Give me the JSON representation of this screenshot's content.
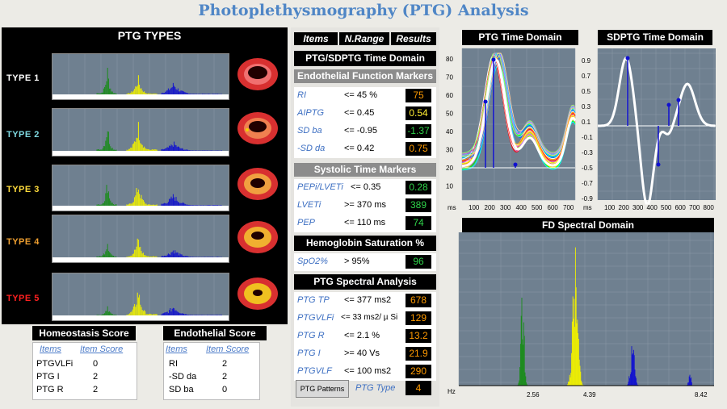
{
  "title": "Photoplethysmography (PTG) Analysis",
  "types_panel": {
    "title": "PTG TYPES",
    "types": [
      {
        "label": "TYPE 1",
        "color": "#ffffff"
      },
      {
        "label": "TYPE 2",
        "color": "#7fd8e0"
      },
      {
        "label": "TYPE 3",
        "color": "#ffdc3c"
      },
      {
        "label": "TYPE 4",
        "color": "#f0a030"
      },
      {
        "label": "TYPE 5",
        "color": "#ff2020"
      }
    ]
  },
  "homeostasis": {
    "title": "Homeostasis Score",
    "col_items": "Items",
    "col_score": "Item Score",
    "rows": [
      {
        "item": "PTGVLFi",
        "score": "0"
      },
      {
        "item": "PTG I",
        "score": "2"
      },
      {
        "item": "PTG R",
        "score": "2"
      }
    ]
  },
  "endothelial": {
    "title": "Endothelial Score",
    "col_items": "Items",
    "col_score": "Item Score",
    "rows": [
      {
        "item": "RI",
        "score": "2"
      },
      {
        "item": "-SD da",
        "score": "2"
      },
      {
        "item": "SD ba",
        "score": "0"
      }
    ]
  },
  "middle": {
    "headers": {
      "items": "Items",
      "range": "N.Range",
      "results": "Results"
    },
    "time_domain_title": "PTG/SDPTG Time Domain",
    "endothelial_title": "Endothelial Function Markers",
    "endothelial_rows": [
      {
        "name": "RI",
        "range": "<= 45 %",
        "value": "75"
      },
      {
        "name": "AIPTG",
        "range": "<= 0.45",
        "value": "0.54"
      },
      {
        "name": "SD ba",
        "range": "<= -0.95",
        "value": "-1.37"
      },
      {
        "name": "-SD da",
        "range": "<= 0.42",
        "value": "0.75"
      }
    ],
    "systolic_title": "Systolic Time Markers",
    "systolic_rows": [
      {
        "name": "PEPi/LVETi",
        "range": "<= 0.35",
        "value": "0.28"
      },
      {
        "name": "LVETi",
        "range": ">= 370 ms",
        "value": "389"
      },
      {
        "name": "PEP",
        "range": "<= 110 ms",
        "value": "74"
      }
    ],
    "hemoglobin_title": "Hemoglobin Saturation %",
    "hemoglobin_rows": [
      {
        "name": "SpO2%",
        "range": "> 95%",
        "value": "96"
      }
    ],
    "spectral_title": "PTG Spectral Analysis",
    "spectral_rows": [
      {
        "name": "PTG TP",
        "range": "<= 377 ms2",
        "value": "678"
      },
      {
        "name": "PTGVLFi",
        "range": "<= 33 ms2/ µ Si",
        "value": "129"
      },
      {
        "name": "PTG R",
        "range": "<= 2.1 %",
        "value": "13.2"
      },
      {
        "name": "PTG I",
        "range": ">= 40 Vs",
        "value": "21.9"
      },
      {
        "name": "PTGVLF",
        "range": "<= 100 ms2",
        "value": "290"
      }
    ],
    "patterns_button": "PTG Patterns",
    "ptg_type_label": "PTG Type",
    "ptg_type_value": "4"
  },
  "ptg_time_domain": {
    "title": "PTG Time Domain",
    "y_ticks": [
      "80",
      "70",
      "60",
      "50",
      "40",
      "30",
      "20",
      "10"
    ],
    "x_ticks": [
      "100",
      "200",
      "300",
      "400",
      "500",
      "600",
      "700"
    ],
    "x_unit": "ms"
  },
  "sdptg_time_domain": {
    "title": "SDPTG Time Domain",
    "y_ticks": [
      "0.9",
      "0.7",
      "0.5",
      "0.3",
      "0.1",
      "-0.1",
      "-0.3",
      "-0.5",
      "-0.7",
      "-0.9"
    ],
    "x_ticks": [
      "100",
      "200",
      "300",
      "400",
      "500",
      "600",
      "700",
      "800"
    ],
    "x_unit": "ms"
  },
  "fd_spectral": {
    "title": "FD Spectral Domain",
    "x_unit": "Hz",
    "x_labels": [
      "2.56",
      "4.39",
      "8.42"
    ]
  },
  "colors": {
    "green": "#1a8c1a",
    "yellow": "#f0f000",
    "blue": "#1010d0",
    "plot_bg": "#6f8090"
  }
}
